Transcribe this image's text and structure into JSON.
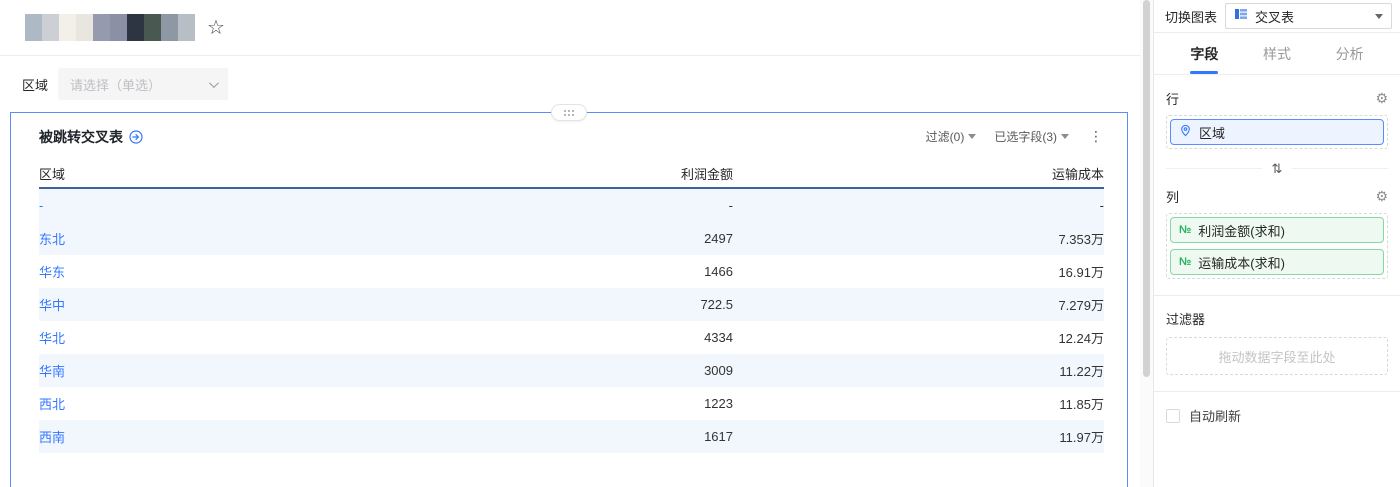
{
  "topbar": {
    "redacted_blocks": [
      "#aeb9c6",
      "#ccd0d4",
      "#f3f0ea",
      "#e9e6e0",
      "#959aae",
      "#8b90a6",
      "#2d3542",
      "#4a5852",
      "#8e98a5",
      "#b7bec6"
    ]
  },
  "filter_bar": {
    "label": "区域",
    "placeholder": "请选择（单选）"
  },
  "chart_card": {
    "title": "被跳转交叉表",
    "toolbar": {
      "filter_label": "过滤(0)",
      "selected_fields_label": "已选字段(3)",
      "more_label": "⋮"
    }
  },
  "chart_data": {
    "type": "table",
    "title": "被跳转交叉表",
    "columns": [
      "区域",
      "利润金额",
      "运输成本"
    ],
    "rows": [
      {
        "region": "-",
        "profit": "-",
        "cost": "-"
      },
      {
        "region": "东北",
        "profit": "2497",
        "cost": "7.353万"
      },
      {
        "region": "华东",
        "profit": "1466",
        "cost": "16.91万"
      },
      {
        "region": "华中",
        "profit": "722.5",
        "cost": "7.279万"
      },
      {
        "region": "华北",
        "profit": "4334",
        "cost": "12.24万"
      },
      {
        "region": "华南",
        "profit": "3009",
        "cost": "11.22万"
      },
      {
        "region": "西北",
        "profit": "1223",
        "cost": "11.85万"
      },
      {
        "region": "西南",
        "profit": "1617",
        "cost": "11.97万"
      }
    ],
    "zebra_shaded_row_indexes": [
      0,
      1,
      3,
      5,
      7
    ]
  },
  "panel": {
    "switch_chart_label": "切换图表",
    "chart_type_value": "交叉表",
    "tabs": [
      {
        "label": "字段",
        "active": true
      },
      {
        "label": "样式",
        "active": false
      },
      {
        "label": "分析",
        "active": false
      }
    ],
    "rows_section": {
      "label": "行",
      "fields": [
        {
          "label": "区域",
          "type": "dimension"
        }
      ]
    },
    "cols_section": {
      "label": "列",
      "fields": [
        {
          "label": "利润金额(求和)",
          "type": "measure"
        },
        {
          "label": "运输成本(求和)",
          "type": "measure"
        }
      ]
    },
    "filters_section": {
      "label": "过滤器",
      "placeholder": "拖动数据字段至此处"
    },
    "auto_refresh_label": "自动刷新"
  },
  "colors": {
    "accent_blue": "#3377ff",
    "link_blue": "#3377ff",
    "card_border": "#5c8df6",
    "zebra_row": "#f2f7fd",
    "header_underline": "#3d6398",
    "dim_chip_bg": "#edf3ff",
    "dim_chip_border": "#5b8cff",
    "measure_chip_bg": "#eefaf1",
    "measure_chip_border": "#86d7a2",
    "measure_icon_green": "#27ae60"
  }
}
